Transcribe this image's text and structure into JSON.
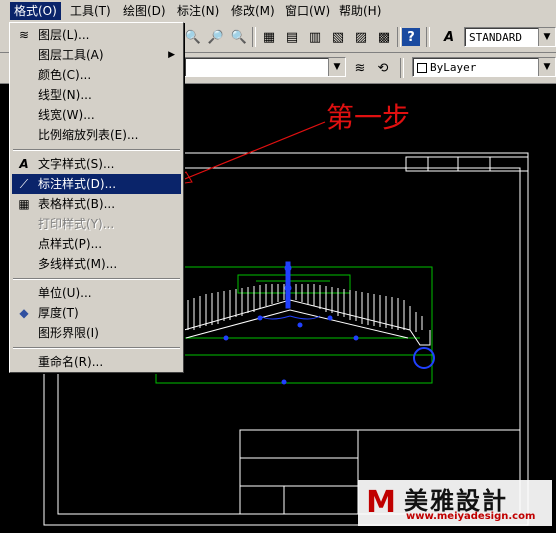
{
  "menubar": {
    "items": [
      {
        "label": "格式(O)"
      },
      {
        "label": "工具(T)"
      },
      {
        "label": "绘图(D)"
      },
      {
        "label": "标注(N)"
      },
      {
        "label": "修改(M)"
      },
      {
        "label": "窗口(W)"
      },
      {
        "label": "帮助(H)"
      }
    ],
    "active_index": 0
  },
  "toolbar": {
    "text_style_value": "STANDARD",
    "layer_value": "",
    "color_value": "ByLayer"
  },
  "format_menu": {
    "items": [
      {
        "label": "图层(L)...",
        "icon": "layers-icon"
      },
      {
        "label": "图层工具(A)",
        "has_submenu": true
      },
      {
        "label": "颜色(C)..."
      },
      {
        "label": "线型(N)..."
      },
      {
        "label": "线宽(W)..."
      },
      {
        "label": "比例缩放列表(E)..."
      },
      {
        "label": "文字样式(S)...",
        "icon": "text-style-icon"
      },
      {
        "label": "标注样式(D)...",
        "icon": "dim-style-icon",
        "highlighted": true
      },
      {
        "label": "表格样式(B)...",
        "icon": "table-style-icon"
      },
      {
        "label": "打印样式(Y)...",
        "disabled": true
      },
      {
        "label": "点样式(P)..."
      },
      {
        "label": "多线样式(M)..."
      },
      {
        "label": "单位(U)..."
      },
      {
        "label": "厚度(T)",
        "icon": "thickness-icon"
      },
      {
        "label": "图形界限(I)"
      },
      {
        "label": "重命名(R)..."
      }
    ]
  },
  "annotation": {
    "text": "第一步",
    "color": "#e01010"
  },
  "watermark": {
    "mark": "M",
    "name": "美雅設計",
    "url": "www.meiyadesign.com"
  },
  "colors": {
    "menu_highlight": "#0a246a",
    "drawing_background": "#000000",
    "cad_green": "#00c000",
    "cad_blue": "#2040ff"
  }
}
